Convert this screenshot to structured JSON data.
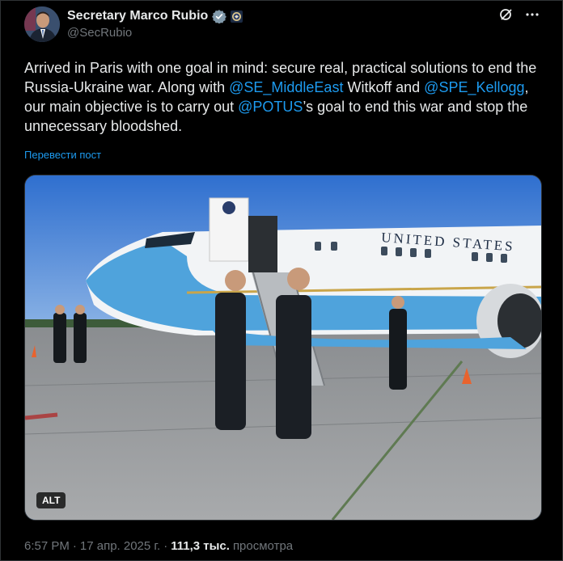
{
  "author": {
    "name": "Secretary Marco Rubio",
    "handle": "@SecRubio"
  },
  "icons": {
    "verified": "verified-badge-icon",
    "affiliation": "state-department-seal-icon",
    "grok": "grok-icon",
    "more": "more-icon"
  },
  "post": {
    "text_1": "Arrived in Paris with one goal in mind: secure real, practical solutions to end the Russia-Ukraine war. Along with ",
    "mention_1": "@SE_MiddleEast",
    "text_2": " Witkoff and ",
    "mention_2": "@SPE_Kellogg",
    "text_3": ", our main objective is to carry out ",
    "mention_3": "@POTUS",
    "text_4": "’s goal to end this war and stop the unnecessary bloodshed.",
    "translate": "Перевести пост"
  },
  "media": {
    "plane_text": "UNITED STATES",
    "alt_label": "ALT"
  },
  "meta": {
    "time": "6:57 PM",
    "separator": "·",
    "date": "17 апр. 2025 г.",
    "views_count": "111,3 тыс.",
    "views_label": "просмотра"
  },
  "colors": {
    "background": "#000000",
    "text": "#e7e9ea",
    "secondary": "#71767b",
    "link": "#1d9bf0",
    "verified": "#829aab"
  }
}
